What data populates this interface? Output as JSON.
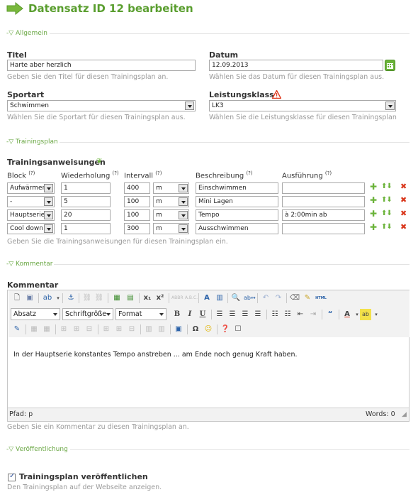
{
  "header": {
    "title": "Datensatz ID 12 bearbeiten",
    "icon": "green-arrow-icon",
    "accent": "#5a9e2f"
  },
  "sections": {
    "allgemein": "Allgemein",
    "trainingsplan": "Trainingsplan",
    "kommentar": "Kommentar",
    "veroeffentlichung": "Veröffentlichung"
  },
  "fields": {
    "titel": {
      "label": "Titel",
      "value": "Harte aber herzlich",
      "hint": "Geben Sie den Titel für diesen Trainingsplan an."
    },
    "datum": {
      "label": "Datum",
      "value": "12.09.2013",
      "hint": "Wählen Sie das Datum für diesen Trainingsplan aus."
    },
    "sportart": {
      "label": "Sportart",
      "value": "Schwimmen",
      "hint": "Wählen Sie die Sportart für diesen Trainingsplan aus."
    },
    "leistungsklasse": {
      "label": "Leistungsklasse",
      "value": "LK3",
      "hint": "Wählen Sie die Leistungsklasse für diesen Trainingsplan"
    }
  },
  "anweisungen": {
    "label": "Trainingsanweisungen",
    "headers": {
      "block": "Block",
      "wiederholung": "Wiederholung",
      "intervall": "Intervall",
      "beschreibung": "Beschreibung",
      "ausfuehrung": "Ausführung",
      "help": "(?)"
    },
    "rows": [
      {
        "block": "Aufwärmen",
        "wiederholung": "1",
        "intervall": "400",
        "einheit": "m",
        "beschreibung": "Einschwimmen",
        "ausfuehrung": ""
      },
      {
        "block": "-",
        "wiederholung": "5",
        "intervall": "100",
        "einheit": "m",
        "beschreibung": "Mini Lagen",
        "ausfuehrung": ""
      },
      {
        "block": "Hauptserie",
        "wiederholung": "20",
        "intervall": "100",
        "einheit": "m",
        "beschreibung": "Tempo",
        "ausfuehrung": "à 2:00min ab"
      },
      {
        "block": "Cool down",
        "wiederholung": "1",
        "intervall": "300",
        "einheit": "m",
        "beschreibung": "Ausschwimmen",
        "ausfuehrung": ""
      }
    ],
    "hint": "Geben Sie die Trainingsanweisungen für diesen Trainingsplan ein."
  },
  "kommentar": {
    "label": "Kommentar",
    "toolbar": {
      "absatz": "Absatz",
      "schriftgroesse": "Schriftgröße",
      "format": "Format",
      "bold": "B",
      "italic": "I",
      "underline": "U",
      "superscript": "x²",
      "subscript": "x₁",
      "quote": "66",
      "omega": "Ω",
      "html": "HTML"
    },
    "content": "In der Hauptserie konstantes Tempo anstreben ... am Ende noch genug Kraft haben.",
    "pfad": "Pfad: p",
    "words": "Words: 0",
    "hint": "Geben Sie ein Kommentar zu diesen Trainingsplan an."
  },
  "publish": {
    "label": "Trainingsplan veröffentlichen",
    "checked": true,
    "hint": "Den Trainingsplan auf der Webseite anzeigen."
  },
  "colors": {
    "green": "#6bb33a",
    "red": "#d9361b",
    "warning": "#e03a1e"
  }
}
